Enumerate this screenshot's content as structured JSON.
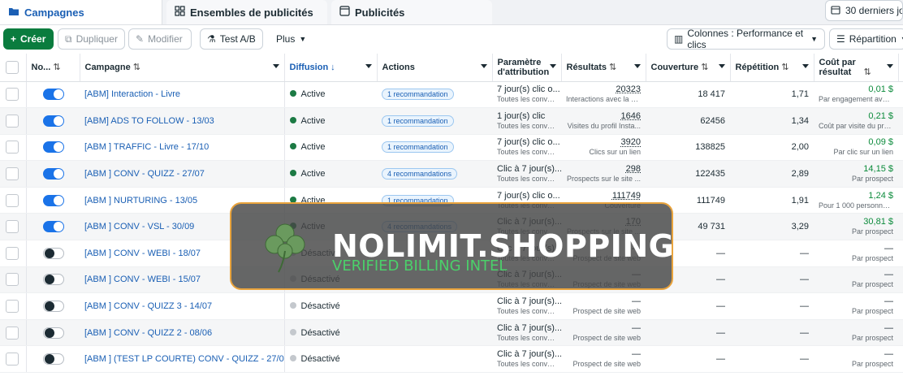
{
  "tabs": {
    "campagnes": "Campagnes",
    "ensembles": "Ensembles de publicités",
    "publicites": "Publicités",
    "date_range": "30 derniers jours"
  },
  "toolbar": {
    "create": "Créer",
    "duplicate": "Dupliquer",
    "edit": "Modifier",
    "ab_test": "Test A/B",
    "more": "Plus",
    "columns": "Colonnes : Performance et clics",
    "breakdown": "Répartition"
  },
  "columns": {
    "name": "No...",
    "campaign": "Campagne",
    "delivery": "Diffusion",
    "actions": "Actions",
    "attribution": "Paramètre d'attribution",
    "results": "Résultats",
    "reach": "Couverture",
    "frequency": "Répétition",
    "cost": "Coût par résultat"
  },
  "rows": [
    {
      "name": "[ABM] Interaction - Livre",
      "delivery": "Active",
      "reco": "1 recommandation",
      "attr": "7 jour(s) clic o...",
      "attr_sub": "Toutes les conver...",
      "results": "20323",
      "results_sub": "Interactions avec la p...",
      "reach": "18 417",
      "freq": "1,71",
      "cost": "0,01 $",
      "cost_sub": "Par engagement avec ...",
      "on": true
    },
    {
      "name": "[ABM] ADS TO FOLLOW - 13/03",
      "delivery": "Active",
      "reco": "1 recommandation",
      "attr": "1 jour(s) clic",
      "attr_sub": "Toutes les conver...",
      "results": "1646",
      "results_sub": "Visites du profil Insta...",
      "reach": "62456",
      "freq": "1,34",
      "cost": "0,21 $",
      "cost_sub": "Coût par visite du profil ...",
      "on": true
    },
    {
      "name": "[ABM ] TRAFFIC - Livre - 17/10",
      "delivery": "Active",
      "reco": "1 recommandation",
      "attr": "7 jour(s) clic o...",
      "attr_sub": "Toutes les conver...",
      "results": "3920",
      "results_sub": "Clics sur un lien",
      "reach": "138825",
      "freq": "2,00",
      "cost": "0,09 $",
      "cost_sub": "Par clic sur un lien",
      "on": true
    },
    {
      "name": "[ABM ] CONV - QUIZZ - 27/07",
      "delivery": "Active",
      "reco": "4 recommandations",
      "attr": "Clic à 7 jour(s)...",
      "attr_sub": "Toutes les conver...",
      "results": "298",
      "results_sub": "Prospects sur le site ...",
      "reach": "122435",
      "freq": "2,89",
      "cost": "14,15 $",
      "cost_sub": "Par prospect",
      "on": true
    },
    {
      "name": "[ABM ] NURTURING - 13/05",
      "delivery": "Active",
      "reco": "1 recommandation",
      "attr": "7 jour(s) clic o...",
      "attr_sub": "Toutes les conver...",
      "results": "111749",
      "results_sub": "Couverture",
      "reach": "111749",
      "freq": "1,91",
      "cost": "1,24 $",
      "cost_sub": "Pour 1 000 personnes...",
      "on": true
    },
    {
      "name": "[ABM ] CONV - VSL - 30/09",
      "delivery": "Active",
      "reco": "4 recommandations",
      "attr": "Clic à 7 jour(s)...",
      "attr_sub": "Toutes les conver...",
      "results": "170",
      "results_sub": "Prospects sur le site ...",
      "reach": "49 731",
      "freq": "3,29",
      "cost": "30,81 $",
      "cost_sub": "Par prospect",
      "on": true
    },
    {
      "name": "[ABM ] CONV - WEBI - 18/07",
      "delivery": "Désactivé",
      "reco": "",
      "attr": "Clic à 7 jour(s)...",
      "attr_sub": "Toutes les conver...",
      "results": "—",
      "results_sub": "Prospect de site web",
      "reach": "—",
      "freq": "—",
      "cost": "—",
      "cost_sub": "Par prospect",
      "on": false
    },
    {
      "name": "[ABM ] CONV - WEBI - 15/07",
      "delivery": "Désactivé",
      "reco": "",
      "attr": "Clic à 7 jour(s)...",
      "attr_sub": "Toutes les conver...",
      "results": "—",
      "results_sub": "Prospect de site web",
      "reach": "—",
      "freq": "—",
      "cost": "—",
      "cost_sub": "Par prospect",
      "on": false
    },
    {
      "name": "[ABM ] CONV - QUIZZ 3 - 14/07",
      "delivery": "Désactivé",
      "reco": "",
      "attr": "Clic à 7 jour(s)...",
      "attr_sub": "Toutes les conver...",
      "results": "—",
      "results_sub": "Prospect de site web",
      "reach": "—",
      "freq": "—",
      "cost": "—",
      "cost_sub": "Par prospect",
      "on": false
    },
    {
      "name": "[ABM ] CONV - QUIZZ 2 - 08/06",
      "delivery": "Désactivé",
      "reco": "",
      "attr": "Clic à 7 jour(s)...",
      "attr_sub": "Toutes les conver...",
      "results": "—",
      "results_sub": "Prospect de site web",
      "reach": "—",
      "freq": "—",
      "cost": "—",
      "cost_sub": "Par prospect",
      "on": false
    },
    {
      "name": "[ABM ] (TEST LP COURTE) CONV - QUIZZ - 27/07...",
      "delivery": "Désactivé",
      "reco": "",
      "attr": "Clic à 7 jour(s)...",
      "attr_sub": "Toutes les conver...",
      "results": "—",
      "results_sub": "Prospect de site web",
      "reach": "—",
      "freq": "—",
      "cost": "—",
      "cost_sub": "Par prospect",
      "on": false
    }
  ],
  "overlay": {
    "brand": "NOLIMIT.SHOPPING",
    "tagline": "VERIFIED BILLING INTEL"
  },
  "colors": {
    "accent": "#1a5fb4",
    "create_green": "#0a7c3e",
    "active_dot": "#1c7a44",
    "overlay_border": "#e9a33c",
    "tag_green": "#4bd06a"
  }
}
